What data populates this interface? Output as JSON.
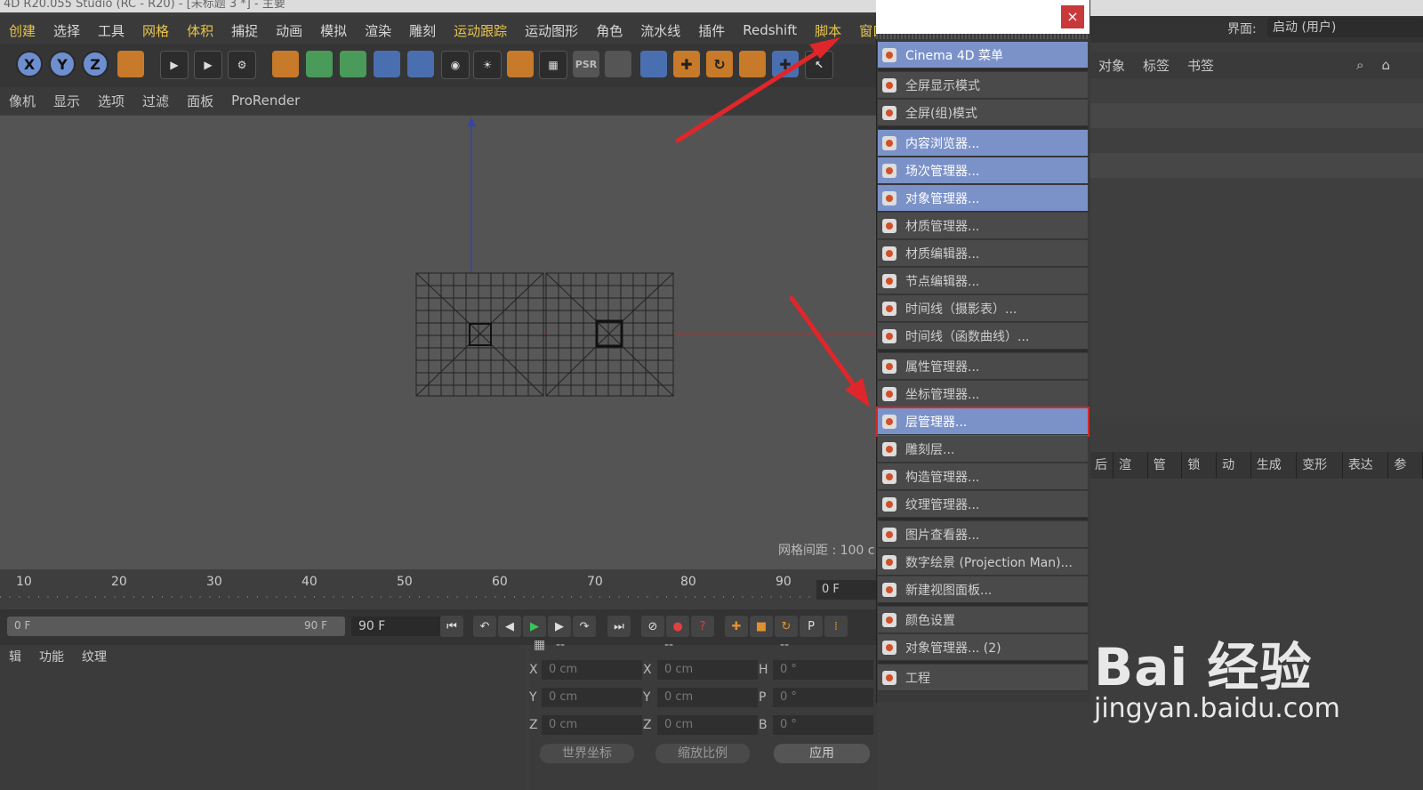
{
  "window": {
    "title": "4D R20.055 Studio (RC - R20) - [未标题 3 *] - 主要"
  },
  "menubar": [
    "创建",
    "选择",
    "工具",
    "网格",
    "体积",
    "捕捉",
    "动画",
    "模拟",
    "渲染",
    "雕刻",
    "运动跟踪",
    "运动图形",
    "角色",
    "流水线",
    "插件",
    "Redshift",
    "脚本",
    "窗口"
  ],
  "toolbar": {
    "axis_x": "X",
    "axis_y": "Y",
    "axis_z": "Z",
    "psr": "PSR"
  },
  "viewmenu": [
    "像机",
    "显示",
    "选项",
    "过滤",
    "面板",
    "ProRender"
  ],
  "viewport": {
    "grid_spacing": "网格间距 : 100 c"
  },
  "timeline": {
    "ticks": [
      "10",
      "20",
      "30",
      "40",
      "50",
      "60",
      "70",
      "80",
      "90"
    ],
    "current_frame": "0 F"
  },
  "playback": {
    "start": "0 F",
    "end": "90 F",
    "range_end": "90 F"
  },
  "material_tabs": [
    "辑",
    "功能",
    "纹理"
  ],
  "coords": {
    "header": [
      "--",
      "--",
      "--"
    ],
    "pos_labels": [
      "X",
      "Y",
      "Z"
    ],
    "size_labels": [
      "X",
      "Y",
      "Z"
    ],
    "rot_labels": [
      "H",
      "P",
      "B"
    ],
    "pos": [
      "0 cm",
      "0 cm",
      "0 cm"
    ],
    "size": [
      "0 cm",
      "0 cm",
      "0 cm"
    ],
    "rot": [
      "0 °",
      "0 °",
      "0 °"
    ],
    "coord_system": "世界坐标",
    "scale_mode": "缩放比例",
    "apply": "应用"
  },
  "right": {
    "layout_label": "界面:",
    "layout_value": "启动 (用户)",
    "menu": [
      "对象",
      "标签",
      "书签"
    ],
    "attr_tabs": [
      "后",
      "渲染",
      "管理",
      "锁定",
      "动画",
      "生成器",
      "变形器",
      "表达式",
      "参考"
    ]
  },
  "dropdown": {
    "close": "×",
    "items": [
      {
        "label": "Cinema 4D 菜单",
        "state": "sel"
      },
      {
        "label": "全屏显示模式",
        "state": ""
      },
      {
        "label": "全屏(组)模式",
        "state": ""
      },
      {
        "label": "内容浏览器...",
        "state": "sel"
      },
      {
        "label": "场次管理器...",
        "state": "sel"
      },
      {
        "label": "对象管理器...",
        "state": "sel"
      },
      {
        "label": "材质管理器...",
        "state": ""
      },
      {
        "label": "材质编辑器...",
        "state": ""
      },
      {
        "label": "节点编辑器...",
        "state": ""
      },
      {
        "label": "时间线（摄影表）...",
        "state": ""
      },
      {
        "label": "时间线（函数曲线）...",
        "state": ""
      },
      {
        "label": "属性管理器...",
        "state": ""
      },
      {
        "label": "坐标管理器...",
        "state": ""
      },
      {
        "label": "层管理器...",
        "state": "hl"
      },
      {
        "label": "雕刻层...",
        "state": ""
      },
      {
        "label": "构造管理器...",
        "state": ""
      },
      {
        "label": "纹理管理器...",
        "state": ""
      },
      {
        "label": "图片查看器...",
        "state": ""
      },
      {
        "label": "数字绘景 (Projection Man)...",
        "state": ""
      },
      {
        "label": "新建视图面板...",
        "state": ""
      },
      {
        "label": "颜色设置",
        "state": ""
      },
      {
        "label": "对象管理器... (2)",
        "state": ""
      },
      {
        "label": "工程",
        "state": ""
      }
    ]
  },
  "watermark": {
    "main": "Bai 经验",
    "sub": "jingyan.baidu.com"
  },
  "colors": {
    "accent": "#7b92c9",
    "highlight_border": "#d02a2a",
    "arrow": "#e0262a"
  }
}
